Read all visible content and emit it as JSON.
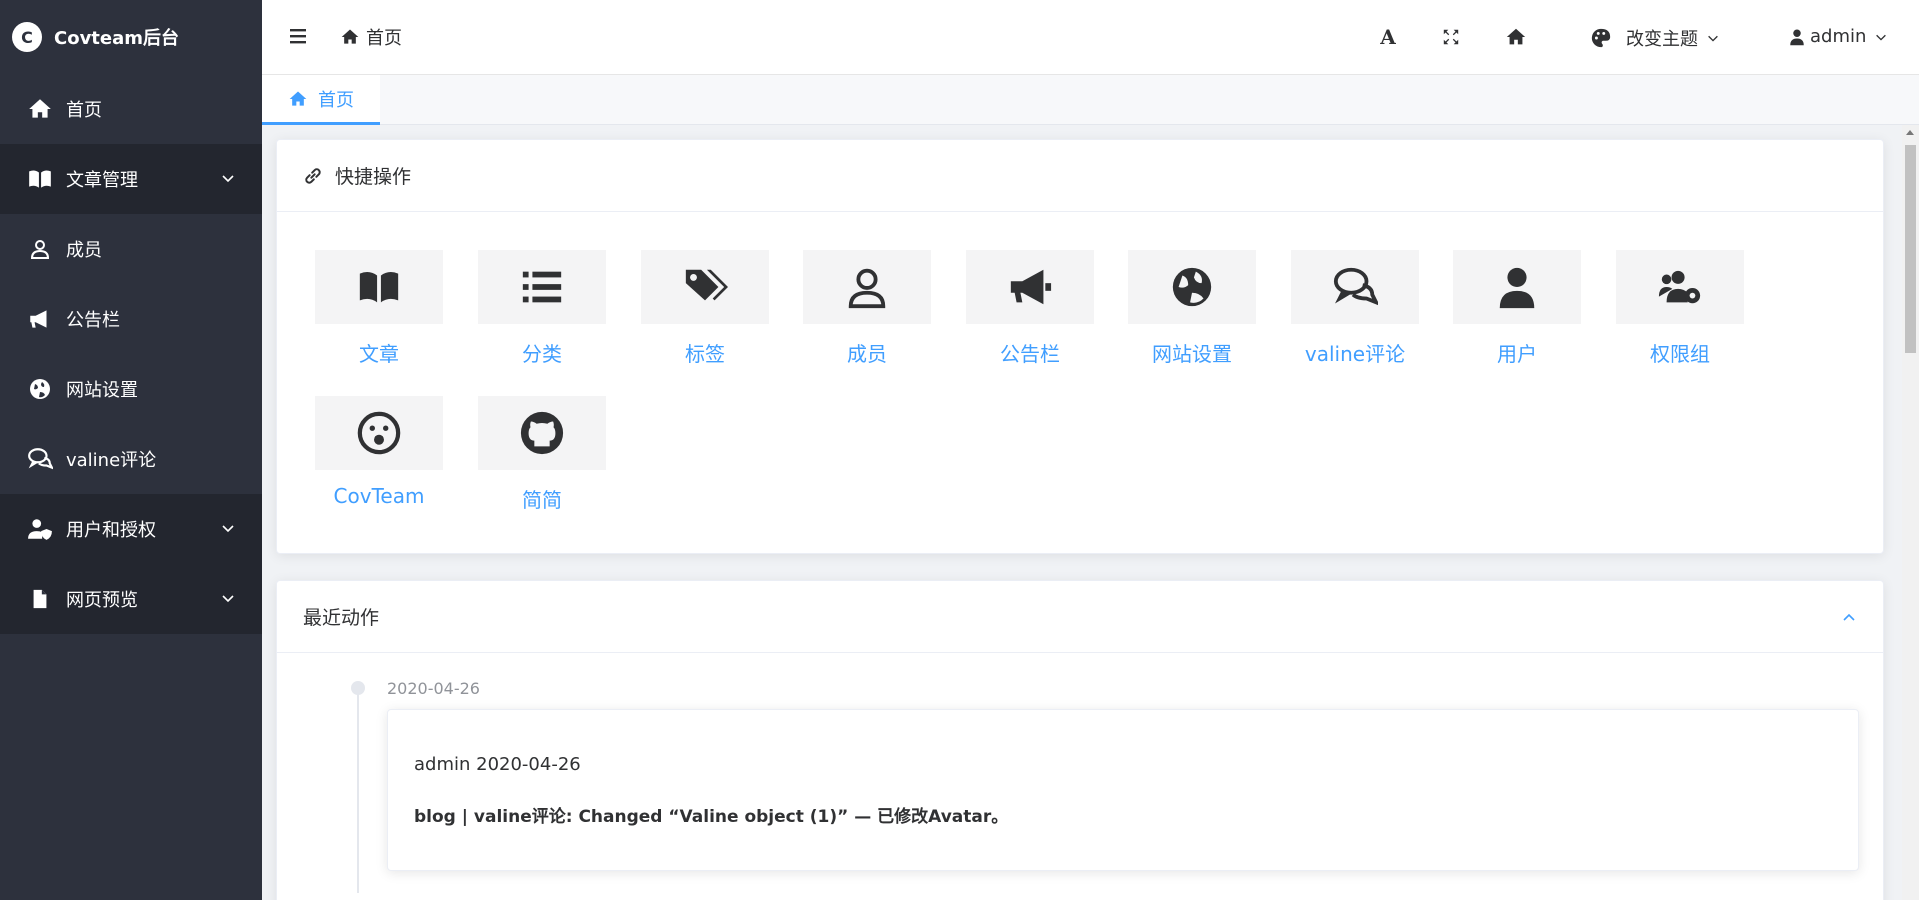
{
  "app": {
    "title": "Covteam后台",
    "logo_char": "C"
  },
  "sidebar": {
    "items": [
      {
        "label": "首页",
        "icon": "home-icon"
      },
      {
        "label": "文章管理",
        "icon": "book-icon",
        "expandable": true
      },
      {
        "label": "成员",
        "icon": "user-outline-icon"
      },
      {
        "label": "公告栏",
        "icon": "bullhorn-icon"
      },
      {
        "label": "网站设置",
        "icon": "globe-icon"
      },
      {
        "label": "valine评论",
        "icon": "comments-icon"
      },
      {
        "label": "用户和授权",
        "icon": "user-shield-icon",
        "expandable": true
      },
      {
        "label": "网页预览",
        "icon": "file-icon",
        "expandable": true
      }
    ]
  },
  "header": {
    "breadcrumb": "首页",
    "theme_label": "改变主题",
    "user_label": "admin",
    "font_icon_char": "A"
  },
  "tabs": [
    {
      "label": "首页"
    }
  ],
  "quick": {
    "title": "快捷操作",
    "tiles": [
      {
        "label": "文章",
        "icon": "book-icon"
      },
      {
        "label": "分类",
        "icon": "list-icon"
      },
      {
        "label": "标签",
        "icon": "tags-icon"
      },
      {
        "label": "成员",
        "icon": "user-outline-icon"
      },
      {
        "label": "公告栏",
        "icon": "bullhorn-icon"
      },
      {
        "label": "网站设置",
        "icon": "globe-icon"
      },
      {
        "label": "valine评论",
        "icon": "comments-icon"
      },
      {
        "label": "用户",
        "icon": "user-icon"
      },
      {
        "label": "权限组",
        "icon": "users-cog-icon"
      },
      {
        "label": "CovTeam",
        "icon": "surprise-icon"
      },
      {
        "label": "简简",
        "icon": "github-icon"
      }
    ]
  },
  "recent": {
    "title": "最近动作",
    "entries": [
      {
        "date": "2020-04-26",
        "title": "admin 2020-04-26",
        "body": "blog | valine评论: Changed “Valine object (1)” — 已修改Avatar。"
      }
    ]
  },
  "colors": {
    "sidebar_bg": "#2d313d",
    "accent": "#409eff",
    "tile_bg": "#f4f4f5"
  }
}
